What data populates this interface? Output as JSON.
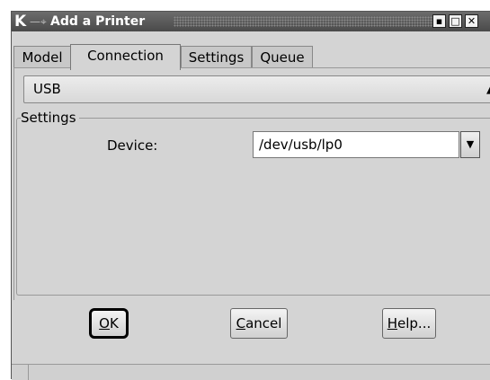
{
  "window": {
    "title": "Add a Printer",
    "app_icon": "K",
    "pin_icon": "pin-icon",
    "buttons": [
      "minimize",
      "maximize",
      "close"
    ]
  },
  "tabs": [
    {
      "label": "Model",
      "active": false
    },
    {
      "label": "Connection",
      "active": true
    },
    {
      "label": "Settings",
      "active": false
    },
    {
      "label": "Queue",
      "active": false
    }
  ],
  "connection": {
    "type_value": "USB",
    "settings_group": "Settings",
    "device_label": "Device:",
    "device_value": "/dev/usb/lp0"
  },
  "buttons": {
    "ok": {
      "mnemonic": "O",
      "rest": "K"
    },
    "cancel": {
      "mnemonic": "C",
      "rest": "ancel"
    },
    "help": {
      "mnemonic": "H",
      "rest": "elp..."
    }
  }
}
